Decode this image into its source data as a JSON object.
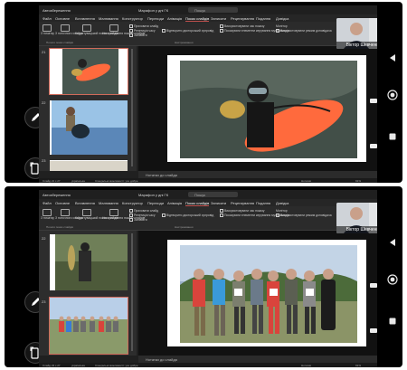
{
  "app": {
    "autosave_label": "Автозбереження",
    "file_title": "Марафон у дні ГК",
    "search_placeholder": "Пошук",
    "tabs": [
      "Файл",
      "Основне",
      "Вставлення",
      "Малювання",
      "Конструктор",
      "Переходи",
      "Анімація",
      "Показ слайдів",
      "Записати",
      "Рецензування",
      "Подання",
      "Довідка"
    ],
    "active_tab": "Показ слайдів"
  },
  "ribbon": {
    "from_start": "З початку",
    "from_current": "З поточного слайда",
    "custom_show": "Користувацький показ слайдів",
    "setup": "Настроювання показу слайдів",
    "hide_slide": "Приховати слайд",
    "rehearse": "Репетиція часу",
    "record": "Записати",
    "play_narrations": "Відтворити дикторський супровід",
    "use_timings": "Використовувати час показу",
    "show_media": "Показувати елементи керування мультимедіа",
    "use_presenter": "Використовувати режим доповідача",
    "monitor": "Монітор",
    "group_start": "Почати показ слайдів",
    "group_setup": "Настроювання",
    "group_monitors": "Монітори"
  },
  "participant": {
    "name": "Віктор Шевченко"
  },
  "screens": [
    {
      "thumb_numbers": [
        "21",
        "22",
        "23"
      ],
      "status_slide": "Слайд 21 з 27",
      "notes": "Нотатки до слайда"
    },
    {
      "thumb_numbers": [
        "22",
        "23"
      ],
      "status_slide": "Слайд 23 з 27",
      "notes": "Нотатки до слайда"
    }
  ],
  "status": {
    "language": "українська",
    "accessibility": "Спеціальні можливості: усе добре",
    "notes_btn": "Нотатки",
    "zoom": "91%"
  },
  "icons": {
    "pen": "pen-icon",
    "screen_rotate": "rotate-screen-icon",
    "back": "back-triangle-icon",
    "home": "home-circle-icon",
    "recents": "recents-square-icon"
  },
  "colors": {
    "accent": "#c0504d",
    "float": "#ff6a3d",
    "sky": "#9ac3e6"
  }
}
